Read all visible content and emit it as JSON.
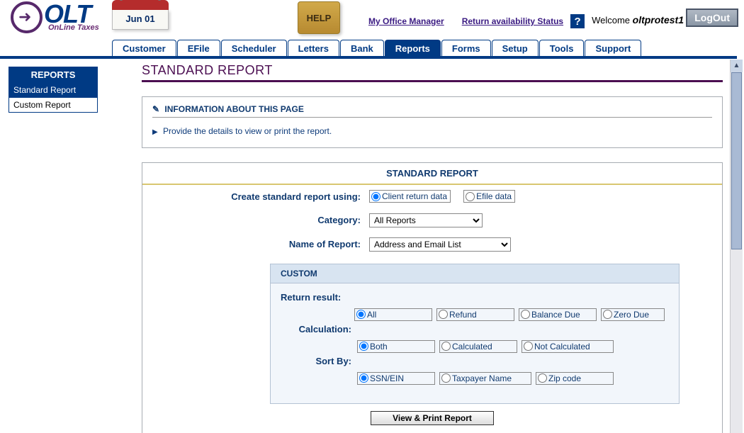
{
  "header": {
    "logo_big": "OLT",
    "logo_sub": "OnLine Taxes",
    "calendar_date": "Jun 01",
    "help_label": "HELP",
    "link_office": "My Office Manager",
    "link_return": "Return availability Status",
    "welcome_prefix": "Welcome ",
    "username": "oltprotest1",
    "logout": "LogOut"
  },
  "tabs": [
    "Customer",
    "EFile",
    "Scheduler",
    "Letters",
    "Bank",
    "Reports",
    "Forms",
    "Setup",
    "Tools",
    "Support"
  ],
  "active_tab": "Reports",
  "sidebar": {
    "title": "REPORTS",
    "items": [
      "Standard Report",
      "Custom Report"
    ],
    "active": "Standard Report"
  },
  "page_title": "STANDARD REPORT",
  "info": {
    "heading": "INFORMATION ABOUT THIS PAGE",
    "line": "Provide the details to view or print the report."
  },
  "form": {
    "title": "STANDARD REPORT",
    "create_label": "Create standard report using:",
    "create_opts": [
      {
        "label": "Client return data",
        "checked": true
      },
      {
        "label": "Efile data",
        "checked": false
      }
    ],
    "category_label": "Category:",
    "category_value": "All Reports",
    "name_label": "Name of Report:",
    "name_value": "Address and Email List",
    "custom": {
      "heading": "CUSTOM",
      "return_label": "Return result:",
      "return_opts": [
        {
          "label": "All",
          "checked": true
        },
        {
          "label": "Refund",
          "checked": false
        },
        {
          "label": "Balance Due",
          "checked": false
        },
        {
          "label": "Zero Due",
          "checked": false
        }
      ],
      "calc_label": "Calculation:",
      "calc_opts": [
        {
          "label": "Both",
          "checked": true
        },
        {
          "label": "Calculated",
          "checked": false
        },
        {
          "label": "Not Calculated",
          "checked": false
        }
      ],
      "sort_label": "Sort By:",
      "sort_opts": [
        {
          "label": "SSN/EIN",
          "checked": true
        },
        {
          "label": "Taxpayer Name",
          "checked": false
        },
        {
          "label": "Zip code",
          "checked": false
        }
      ]
    },
    "view_button": "View & Print Report"
  }
}
